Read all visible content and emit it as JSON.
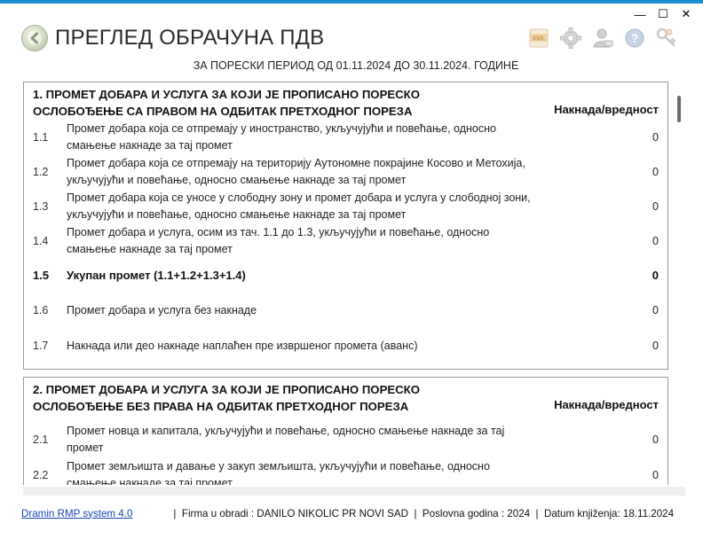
{
  "window": {
    "minimize": "—",
    "maximize": "☐",
    "close": "✕"
  },
  "header": {
    "title": "ПРЕГЛЕД ОБРАЧУНА ПДВ",
    "period": "ЗА ПОРЕСКИ ПЕРИОД ОД 01.11.2024 ДО 30.11.2024. ГОДИНЕ",
    "xml_label": "XML"
  },
  "sections": [
    {
      "title": "1. ПРОМЕТ ДОБАРА И УСЛУГА ЗА КОЈИ ЈЕ ПРОПИСАНО ПОРЕСКО ОСЛОБОЂЕЊЕ СА ПРАВОМ НА ОДБИТАК ПРЕТХОДНОГ ПОРЕЗА",
      "column": "Накнада/вредност",
      "rows": [
        {
          "num": "1.1",
          "desc": "Промет добара која се отпремају у иностранство, укључујући и повећање, односно смањење накнаде за тај промет",
          "value": "0"
        },
        {
          "num": "1.2",
          "desc": "Промет добара која се отпремају на територију Аутономне покрајине Косово и Метохија, укључујући и повећање, односно смањење накнаде за тај промет",
          "value": "0"
        },
        {
          "num": "1.3",
          "desc": "Промет добара која се уносе у слободну зону и промет добара и услуга у слободној зони, укључујући и повећање, односно смањење накнаде за тај промет",
          "value": "0"
        },
        {
          "num": "1.4",
          "desc": "Промет добара и услуга, осим из тач. 1.1 до 1.3, укључујући и повећање, односно смањење накнаде за тај промет",
          "value": "0"
        },
        {
          "num": "1.5",
          "desc": "Укупан промет (1.1+1.2+1.3+1.4)",
          "value": "0",
          "total": true
        },
        {
          "num": "1.6",
          "desc": "Промет добара и услуга без накнаде",
          "value": "0"
        },
        {
          "num": "1.7",
          "desc": "Накнада или део накнаде наплаћен пре извршеног промета (аванс)",
          "value": "0"
        }
      ]
    },
    {
      "title": "2. ПРОМЕТ ДОБАРА И УСЛУГА ЗА КОЈИ ЈЕ ПРОПИСАНО ПОРЕСКО ОСЛОБОЂЕЊЕ БЕЗ ПРАВА НА ОДБИТАК ПРЕТХОДНОГ ПОРЕЗА",
      "column": "Накнада/вредност",
      "rows": [
        {
          "num": "2.1",
          "desc": "Промет новца и капитала, укључујући и повећање, односно смањење накнаде за тај промет",
          "value": "0"
        },
        {
          "num": "2.2",
          "desc": "Промет земљишта и давање у закуп земљишта, укључујући и повећање, односно смањење накнаде за тај промет",
          "value": "0"
        }
      ]
    }
  ],
  "status": {
    "app_link": "Dramin RMP system 4.0",
    "info": "|  Firma u obradi : DANILO NIKOLIC PR NOVI SAD  |  Poslovna godina : 2024  |  Datum knjiženja: 18.11.2024"
  },
  "icons": {
    "back": "back-arrow-icon",
    "xml": "xml-export-icon",
    "settings": "gear-icon",
    "user": "user-icon",
    "help": "help-icon",
    "keys": "keys-icon"
  },
  "colors": {
    "topbar": "#1b8fd2",
    "link": "#1746b8",
    "border": "#9a9a9a"
  }
}
